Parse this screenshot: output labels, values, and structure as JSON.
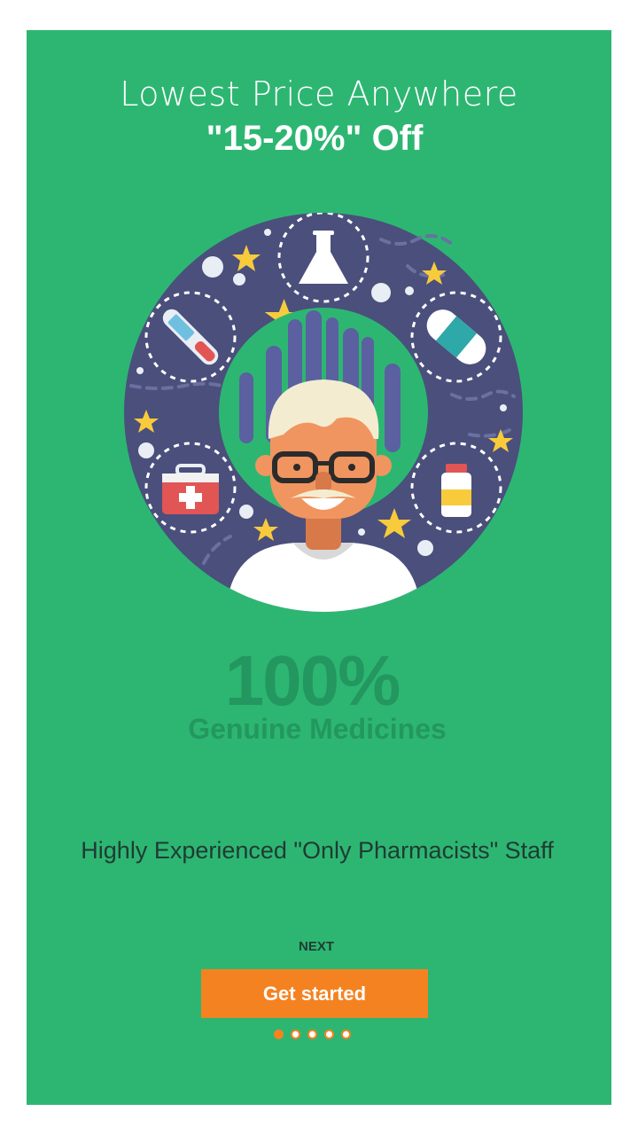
{
  "colors": {
    "background": "#2db672",
    "accent": "#f58220",
    "text_dark": "#1f3b33",
    "stat_green": "#23975f",
    "ring_navy": "#4a4f7c"
  },
  "header": {
    "line1": "Lowest Price Anywhere",
    "line2": "\"15-20%\" Off"
  },
  "stat": {
    "value": "100%",
    "label": "Genuine Medicines"
  },
  "tagline": "Highly Experienced \"Only Pharmacists\" Staff",
  "actions": {
    "next_label": "NEXT",
    "get_started_label": "Get started"
  },
  "pager": {
    "total_pages": 5,
    "current_page": 1
  },
  "illustration": {
    "icons": [
      "flask-icon",
      "thermometer-icon",
      "bandage-icon",
      "first-aid-kit-icon",
      "pill-bottle-icon",
      "pharmacist-avatar"
    ]
  }
}
